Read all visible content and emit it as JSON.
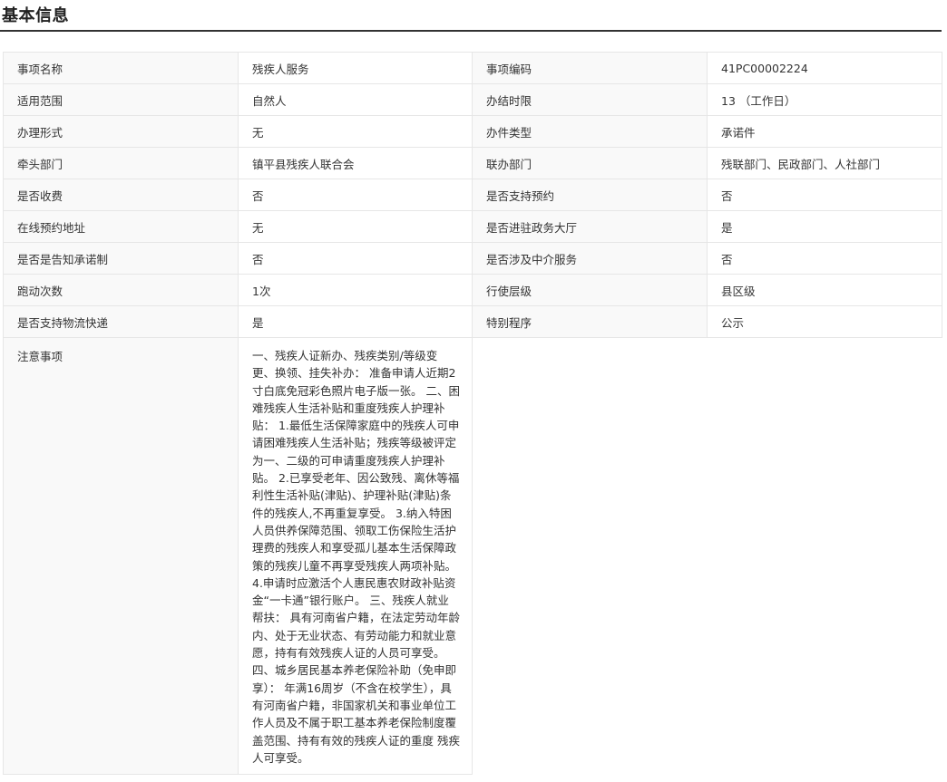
{
  "section": {
    "title": "基本信息"
  },
  "rows": [
    {
      "l1": "事项名称",
      "v1": "残疾人服务",
      "l2": "事项编码",
      "v2": "41PC00002224"
    },
    {
      "l1": "适用范围",
      "v1": "自然人",
      "l2": "办结时限",
      "v2": "13 （工作日）"
    },
    {
      "l1": "办理形式",
      "v1": "无",
      "l2": "办件类型",
      "v2": "承诺件"
    },
    {
      "l1": "牵头部门",
      "v1": "镇平县残疾人联合会",
      "l2": "联办部门",
      "v2": "残联部门、民政部门、人社部门"
    },
    {
      "l1": "是否收费",
      "v1": "否",
      "l2": "是否支持预约",
      "v2": "否"
    },
    {
      "l1": "在线预约地址",
      "v1": "无",
      "l2": "是否进驻政务大厅",
      "v2": "是"
    },
    {
      "l1": "是否是告知承诺制",
      "v1": "否",
      "l2": "是否涉及中介服务",
      "v2": "否"
    },
    {
      "l1": "跑动次数",
      "v1": "1次",
      "l2": "行使层级",
      "v2": "县区级"
    },
    {
      "l1": "是否支持物流快递",
      "v1": "是",
      "l2": "特别程序",
      "v2": "公示"
    }
  ],
  "notes": {
    "label": "注意事项",
    "text": "一、残疾人证新办、残疾类别/等级变更、换领、挂失补办： 准备申请人近期2寸白底免冠彩色照片电子版一张。 二、困难残疾人生活补贴和重度残疾人护理补贴： 1.最低生活保障家庭中的残疾人可申请困难残疾人生活补贴；残疾等级被评定为一、二级的可申请重度残疾人护理补贴。 2.已享受老年、因公致残、离休等福利性生活补贴(津贴)、护理补贴(津贴)条件的残疾人,不再重复享受。 3.纳入特困人员供养保障范围、领取工伤保险生活护理费的残疾人和享受孤儿基本生活保障政策的残疾儿童不再享受残疾人两项补贴。 4.申请时应激活个人惠民惠农财政补贴资金“一卡通”银行账户。 三、残疾人就业帮扶： 具有河南省户籍，在法定劳动年龄内、处于无业状态、有劳动能力和就业意愿，持有有效残疾人证的人员可享受。 四、城乡居民基本养老保险补助（免申即享）： 年满16周岁（不含在校学生），具有河南省户籍，非国家机关和事业单位工作人员及不属于职工基本养老保险制度覆盖范围、持有有效的残疾人证的重度 残疾人可享受。"
  }
}
